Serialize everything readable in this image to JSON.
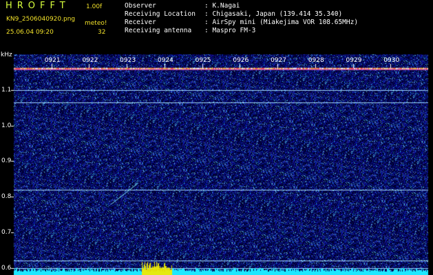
{
  "header": {
    "title": "HROFFT",
    "version": "1.00f",
    "filename": "KN9_2506040920.png",
    "meteo_label": "meteo!",
    "datetime": "25.06.04 09:20",
    "count": "32"
  },
  "info": [
    {
      "label": "Observer",
      "value": ": K.Nagai"
    },
    {
      "label": "Receiving Location",
      "value": ": Chigasaki, Japan (139.414 35.340)"
    },
    {
      "label": "Receiver",
      "value": ": AirSpy mini (Miakejima VOR 108.65MHz)"
    },
    {
      "label": "Receiving antenna",
      "value": ": Maspro FM-3"
    }
  ],
  "chart_data": {
    "type": "heatmap",
    "ylabel": "kHz",
    "time_ticks": [
      "0921",
      "0922",
      "0923",
      "0924",
      "0925",
      "0926",
      "0927",
      "0928",
      "0929",
      "0930"
    ],
    "freq_ticks": [
      "1.1",
      "1.0",
      "0.9",
      "0.8",
      "0.7",
      "0.6"
    ],
    "freq_range_khz": [
      0.58,
      1.2
    ],
    "time_range_minutes": [
      920,
      931
    ],
    "horizontal_lines_khz": [
      1.16,
      1.1,
      1.065,
      0.82,
      0.62,
      0.6
    ],
    "meteor_trace": {
      "start_time": "0923.3",
      "start_khz": 0.838,
      "end_time": "0922.6",
      "end_khz": 0.78
    },
    "colors": {
      "background": "#00003a",
      "noise": "#2b4cff",
      "band": "#9fd7ff",
      "bottom_bar": "#1ee8ff",
      "peak": "#f3ea00"
    }
  }
}
